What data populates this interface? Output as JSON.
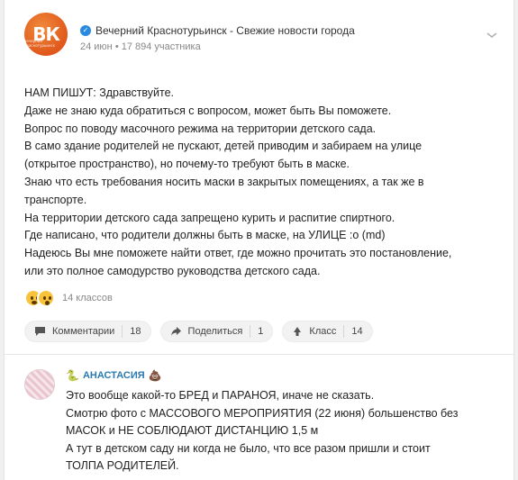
{
  "post": {
    "group_name": "Вечерний Краснотурьинск - Свежие новости города",
    "logo_text": "ВК",
    "logo_subtext": "вечерний краснотурьинск",
    "meta": "24 июн • 17 894 участника",
    "lines": [
      "НАМ ПИШУТ: Здравствуйте.",
      "Даже не знаю куда обратиться с вопросом, может быть Вы поможете.",
      "Вопрос по поводу масочного режима на территории детского сада.",
      "В само здание родителей не пускают, детей приводим и забираем на улице",
      "(открытое пространство), но почему-то требуют быть в маске.",
      "Знаю что есть требования носить маски в закрытых помещениях, а так же в",
      "транспорте.",
      "На территории детского сада запрещено курить и распитие спиртного.",
      "Где написано, что родители должны быть в маске, на УЛИЦЕ :o (md)",
      "Надеюсь Вы мне поможете найти ответ, где можно прочитать это постановление,",
      "или это полное самодурство руководства детского сада."
    ],
    "reactions_count": "14 классов"
  },
  "actions": {
    "comments_label": "Комментарии",
    "comments_count": "18",
    "share_label": "Поделиться",
    "share_count": "1",
    "like_label": "Класс",
    "like_count": "14"
  },
  "comment": {
    "author": "АНАСТАСИЯ",
    "lines": [
      "Это вообще какой-то БРЕД и ПАРАНОЯ, иначе не сказать.",
      "Смотрю фото с МАССОВОГО МЕРОПРИЯТИЯ (22 июня) большенство без",
      "МАСОК и НЕ СОБЛЮДАЮТ ДИСТАНЦИЮ 1,5 м",
      "А тут в детском саду ни когда не было, что все разом пришли и стоит",
      "ТОЛПА РОДИТЕЛЕЙ."
    ]
  },
  "colors": {
    "accent_orange": "#e0581c",
    "verified_blue": "#2a8ae0",
    "author_blue": "#2a7ab0"
  },
  "icons": [
    "verified-icon",
    "chevron-down-icon",
    "comment-icon",
    "share-icon",
    "like-icon",
    "snake-icon",
    "poop-icon"
  ]
}
